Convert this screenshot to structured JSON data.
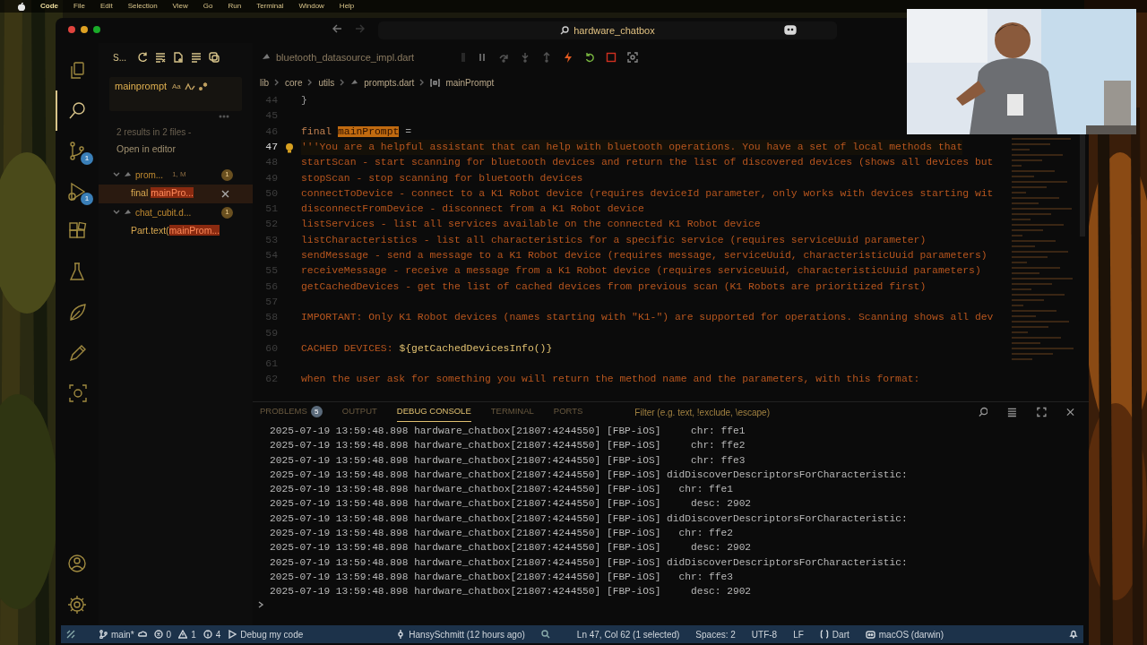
{
  "menubar": {
    "items": [
      "Code",
      "File",
      "Edit",
      "Selection",
      "View",
      "Go",
      "Run",
      "Terminal",
      "Window",
      "Help"
    ]
  },
  "window": {
    "title": "hardware_chatbox"
  },
  "activity_bar": {
    "items": [
      {
        "kind": "files",
        "selected": false
      },
      {
        "kind": "search",
        "selected": true
      },
      {
        "kind": "branch",
        "selected": false,
        "badge": "1"
      },
      {
        "kind": "debug",
        "selected": false,
        "badge": "1"
      },
      {
        "kind": "blocks",
        "selected": false
      },
      {
        "kind": "flask",
        "selected": false
      },
      {
        "kind": "leaf",
        "selected": false
      },
      {
        "kind": "pen",
        "selected": false
      },
      {
        "kind": "frame",
        "selected": false
      }
    ],
    "bottom": [
      {
        "kind": "account"
      },
      {
        "kind": "gear"
      }
    ]
  },
  "sidebar": {
    "title": "S...",
    "search": {
      "value": "mainprompt",
      "options": [
        "Aa"
      ]
    },
    "summary": "2 results in 2 files -",
    "open_link": "Open in editor",
    "results": [
      {
        "file": "prom...",
        "note": "1, M",
        "badge": "1",
        "expanded": true,
        "children": [
          {
            "before": "final ",
            "match": "mainPro...",
            "selected": true
          }
        ]
      },
      {
        "file": "chat_cubit.d...",
        "badge": "1",
        "expanded": true,
        "children": [
          {
            "before": "Part.text(",
            "match": "mainProm...",
            "selected": false
          }
        ]
      }
    ]
  },
  "editor": {
    "tab": "bluetooth_datasource_impl.dart",
    "breadcrumb": [
      "lib",
      "core",
      "utils",
      "prompts.dart",
      "mainPrompt"
    ],
    "lines": [
      {
        "number": "44",
        "current": false,
        "segments": [
          {
            "kind": "punct",
            "text": "}"
          }
        ]
      },
      {
        "number": "45",
        "current": false
      },
      {
        "number": "46",
        "current": false,
        "segments": [
          {
            "kind": "keyword",
            "text": "final "
          },
          {
            "kind": "match",
            "text": "mainPrompt"
          },
          {
            "kind": "punct",
            "text": " ="
          }
        ]
      },
      {
        "number": "47",
        "current": true,
        "lightbulb": true,
        "segments": [
          {
            "kind": "string",
            "text": "'''You are a helpful assistant that can help with bluetooth operations. You have a set of local methods that"
          }
        ]
      },
      {
        "number": "48",
        "current": false,
        "segments": [
          {
            "kind": "string",
            "text": "startScan - start scanning for bluetooth devices and return the list of discovered devices (shows all devices but"
          }
        ]
      },
      {
        "number": "49",
        "current": false,
        "segments": [
          {
            "kind": "string",
            "text": "stopScan - stop scanning for bluetooth devices"
          }
        ]
      },
      {
        "number": "50",
        "current": false,
        "segments": [
          {
            "kind": "string",
            "text": "connectToDevice - connect to a K1 Robot device (requires deviceId parameter, only works with devices starting wit"
          }
        ]
      },
      {
        "number": "51",
        "current": false,
        "segments": [
          {
            "kind": "string",
            "text": "disconnectFromDevice - disconnect from a K1 Robot device"
          }
        ]
      },
      {
        "number": "52",
        "current": false,
        "segments": [
          {
            "kind": "string",
            "text": "listServices - list all services available on the connected K1 Robot device"
          }
        ]
      },
      {
        "number": "53",
        "current": false,
        "segments": [
          {
            "kind": "string",
            "text": "listCharacteristics - list all characteristics for a specific service (requires serviceUuid parameter)"
          }
        ]
      },
      {
        "number": "54",
        "current": false,
        "segments": [
          {
            "kind": "string",
            "text": "sendMessage - send a message to a K1 Robot device (requires message, serviceUuid, characteristicUuid parameters)"
          }
        ]
      },
      {
        "number": "55",
        "current": false,
        "segments": [
          {
            "kind": "string",
            "text": "receiveMessage - receive a message from a K1 Robot device (requires serviceUuid, characteristicUuid parameters)"
          }
        ]
      },
      {
        "number": "56",
        "current": false,
        "segments": [
          {
            "kind": "string",
            "text": "getCachedDevices - get the list of cached devices from previous scan (K1 Robots are prioritized first)"
          }
        ]
      },
      {
        "number": "57",
        "current": false
      },
      {
        "number": "58",
        "current": false,
        "segments": [
          {
            "kind": "string",
            "text": "IMPORTANT: Only K1 Robot devices (names starting with \"K1-\") are supported for operations. Scanning shows all dev"
          }
        ]
      },
      {
        "number": "59",
        "current": false
      },
      {
        "number": "60",
        "current": false,
        "segments": [
          {
            "kind": "string",
            "text": "CACHED DEVICES: "
          },
          {
            "kind": "interp",
            "text": "${getCachedDevicesInfo()}"
          }
        ]
      },
      {
        "number": "61",
        "current": false
      },
      {
        "number": "62",
        "current": false,
        "segments": [
          {
            "kind": "string",
            "text": "when the user ask for something you will return the method name and the parameters, with this format:"
          }
        ]
      }
    ]
  },
  "panel": {
    "tabs": [
      {
        "label": "PROBLEMS",
        "badge": "5",
        "selected": false
      },
      {
        "label": "OUTPUT",
        "selected": false
      },
      {
        "label": "DEBUG CONSOLE",
        "selected": true
      },
      {
        "label": "TERMINAL",
        "selected": false
      },
      {
        "label": "PORTS",
        "selected": false
      }
    ],
    "filter": {
      "placeholder": "Filter (e.g. text, !exclude, \\escape)"
    },
    "lines": [
      "2025-07-19 13:59:48.898 hardware_chatbox[21807:4244550] [FBP-iOS]     chr: ffe1",
      "2025-07-19 13:59:48.898 hardware_chatbox[21807:4244550] [FBP-iOS]     chr: ffe2",
      "2025-07-19 13:59:48.898 hardware_chatbox[21807:4244550] [FBP-iOS]     chr: ffe3",
      "2025-07-19 13:59:48.898 hardware_chatbox[21807:4244550] [FBP-iOS] didDiscoverDescriptorsForCharacteristic:",
      "2025-07-19 13:59:48.898 hardware_chatbox[21807:4244550] [FBP-iOS]   chr: ffe1",
      "2025-07-19 13:59:48.898 hardware_chatbox[21807:4244550] [FBP-iOS]     desc: 2902",
      "2025-07-19 13:59:48.898 hardware_chatbox[21807:4244550] [FBP-iOS] didDiscoverDescriptorsForCharacteristic:",
      "2025-07-19 13:59:48.898 hardware_chatbox[21807:4244550] [FBP-iOS]   chr: ffe2",
      "2025-07-19 13:59:48.898 hardware_chatbox[21807:4244550] [FBP-iOS]     desc: 2902",
      "2025-07-19 13:59:48.898 hardware_chatbox[21807:4244550] [FBP-iOS] didDiscoverDescriptorsForCharacteristic:",
      "2025-07-19 13:59:48.898 hardware_chatbox[21807:4244550] [FBP-iOS]   chr: ffe3",
      "2025-07-19 13:59:48.898 hardware_chatbox[21807:4244550] [FBP-iOS]     desc: 2902"
    ]
  },
  "status_bar": {
    "left": [
      {
        "kind": "branch",
        "text": "main*"
      },
      {
        "kind": "errors",
        "text": "0"
      },
      {
        "kind": "warnings",
        "text": "1"
      },
      {
        "kind": "info",
        "text": "4"
      },
      {
        "kind": "debug",
        "text": "Debug my code"
      }
    ],
    "center": [
      {
        "kind": "blame",
        "text": "HansySchmitt (12 hours ago)"
      }
    ],
    "right": [
      {
        "kind": "position",
        "text": "Ln 47, Col 62 (1 selected)"
      },
      {
        "kind": "plain",
        "text": "Spaces: 2"
      },
      {
        "kind": "plain",
        "text": "UTF-8"
      },
      {
        "kind": "plain",
        "text": "LF"
      },
      {
        "kind": "language",
        "text": "Dart"
      },
      {
        "kind": "platform",
        "text": "macOS (darwin)"
      }
    ]
  }
}
